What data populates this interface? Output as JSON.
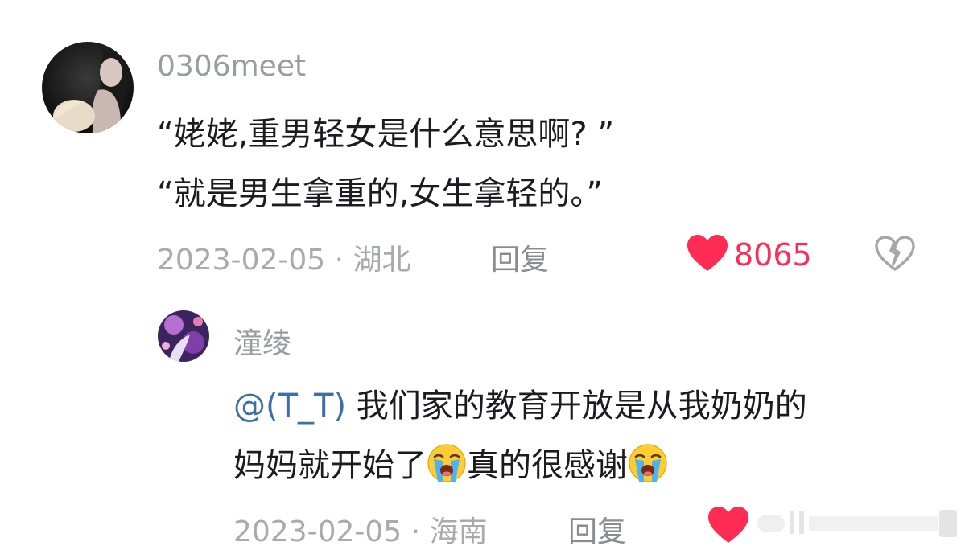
{
  "colors": {
    "like_red": "#fe2c55",
    "mention_blue": "#3e6fa6",
    "meta_gray": "#a8aab0"
  },
  "comments": [
    {
      "username": "0306meet",
      "lines": [
        "“姥姥,重男轻女是什么意思啊? ”",
        "“就是男生拿重的,女生拿轻的。”"
      ],
      "date": "2023-02-05",
      "location": "湖北",
      "reply_label": "回复",
      "likes": "8065",
      "like_icon": "heart-filled-icon",
      "dislike_icon": "broken-heart-icon"
    }
  ],
  "reply": {
    "username": "潼绫",
    "mention": "@(T_T)",
    "line1_rest": " 我们家的教育开放是从我奶奶的",
    "line2_a": "妈妈就开始了",
    "line2_b": "真的很感谢",
    "emoji_icon": "loudly-crying-face-icon",
    "date": "2023-02-05",
    "location": "海南",
    "reply_label": "回复",
    "like_icon": "heart-filled-icon"
  }
}
